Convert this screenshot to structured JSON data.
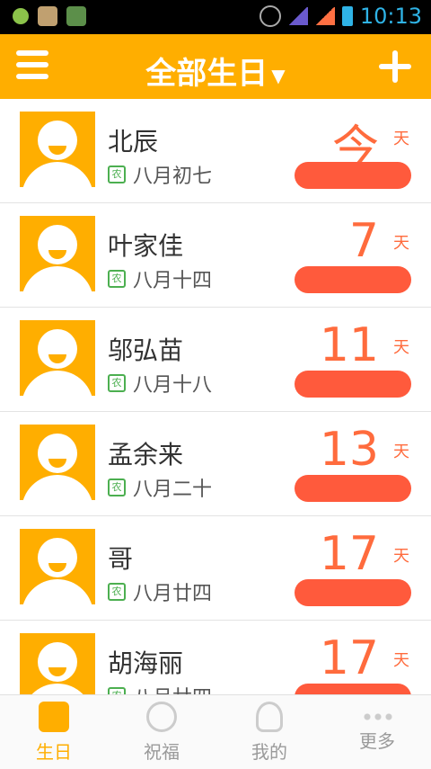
{
  "status_bar": {
    "time": "10:13"
  },
  "header": {
    "title": "全部生日",
    "caret": "▼"
  },
  "list": [
    {
      "name": "北辰",
      "lunar": "八月初七",
      "days": "今",
      "unit": "天"
    },
    {
      "name": "叶家佳",
      "lunar": "八月十四",
      "days": "7",
      "unit": "天"
    },
    {
      "name": "邬弘苗",
      "lunar": "八月十八",
      "days": "11",
      "unit": "天"
    },
    {
      "name": "孟余来",
      "lunar": "八月二十",
      "days": "13",
      "unit": "天"
    },
    {
      "name": "哥",
      "lunar": "八月廿四",
      "days": "17",
      "unit": "天"
    },
    {
      "name": "胡海丽",
      "lunar": "八月廿四",
      "days": "17",
      "unit": "天"
    }
  ],
  "tabs": [
    {
      "label": "生日",
      "active": true
    },
    {
      "label": "祝福",
      "active": false
    },
    {
      "label": "我的",
      "active": false
    },
    {
      "label": "更多",
      "active": false
    }
  ],
  "nong_label": "农",
  "colors": {
    "brand": "#ffae00",
    "days": "#ff6b3d",
    "nong": "#4caf50"
  }
}
